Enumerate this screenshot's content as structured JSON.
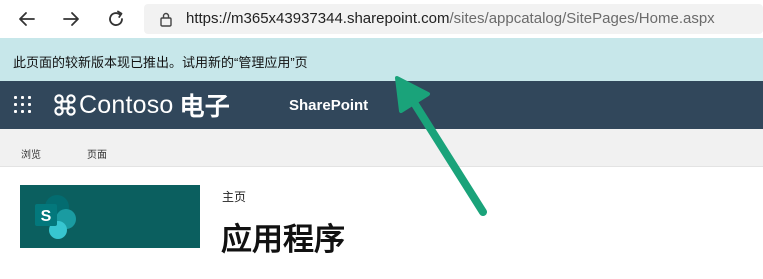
{
  "browser": {
    "url_host": "https://m365x43937344.sharepoint.com",
    "url_path": "/sites/appcatalog/SitePages/Home.aspx"
  },
  "notification": {
    "text": "此页面的较新版本现已推出。试用新的“管理应用”页"
  },
  "suite_bar": {
    "brand_name": "Contoso",
    "brand_suffix": "电子",
    "product_label": "SharePoint"
  },
  "ribbon": {
    "tabs": [
      "浏览",
      "页面"
    ]
  },
  "page": {
    "breadcrumb": "主页",
    "title": "应用程序"
  },
  "colors": {
    "notification_bg": "#c7e7ea",
    "suite_bar_bg": "#31475b",
    "site_logo_bg": "#0b5f5f",
    "arrow": "#1aa37a"
  },
  "icons": [
    "back-icon",
    "forward-icon",
    "refresh-icon",
    "lock-icon",
    "app-launcher-icon",
    "contoso-logo-icon",
    "sharepoint-icon"
  ]
}
